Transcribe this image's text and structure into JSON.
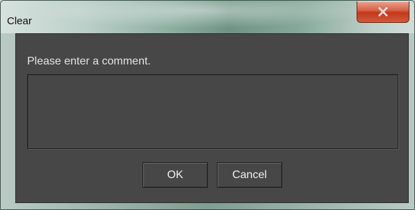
{
  "window": {
    "title": "Clear",
    "close_icon": "close-icon"
  },
  "dialog": {
    "prompt": "Please enter a comment.",
    "comment_value": "",
    "ok_label": "OK",
    "cancel_label": "Cancel"
  },
  "colors": {
    "content_background": "#474747",
    "close_button": "#c4391c",
    "text": "#e4e4e4"
  }
}
